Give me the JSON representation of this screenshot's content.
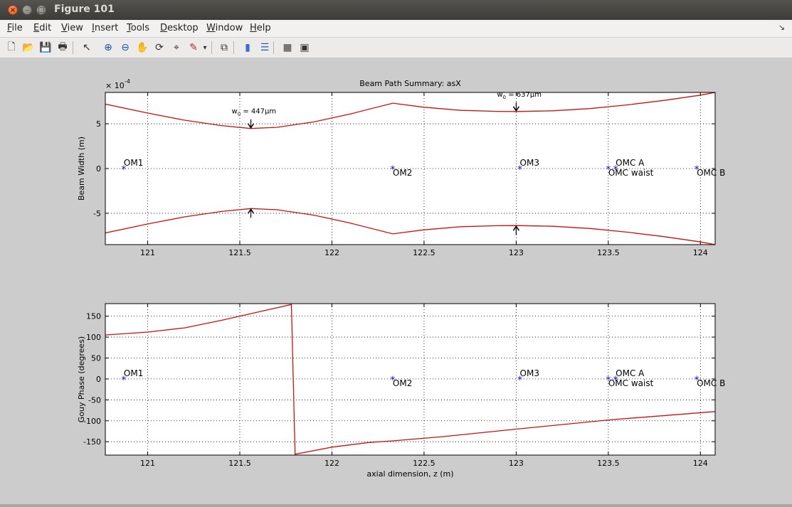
{
  "window": {
    "title": "Figure 101"
  },
  "menu": [
    {
      "label": "File",
      "mn": "F",
      "rest": "ile"
    },
    {
      "label": "Edit",
      "mn": "E",
      "rest": "dit"
    },
    {
      "label": "View",
      "mn": "V",
      "rest": "iew"
    },
    {
      "label": "Insert",
      "mn": "I",
      "rest": "nsert"
    },
    {
      "label": "Tools",
      "mn": "T",
      "rest": "ools"
    },
    {
      "label": "Desktop",
      "mn": "D",
      "rest": "esktop"
    },
    {
      "label": "Window",
      "mn": "W",
      "rest": "indow"
    },
    {
      "label": "Help",
      "mn": "H",
      "rest": "elp"
    }
  ],
  "toolbar": [
    "new-file-icon",
    "open-folder-icon",
    "save-icon",
    "print-icon",
    "pointer-icon",
    "zoom-in-icon",
    "zoom-out-icon",
    "pan-hand-icon",
    "rotate-3d-icon",
    "data-cursor-icon",
    "brush-icon",
    "brush-dropdown-icon",
    "link-plot-icon",
    "colorbar-icon",
    "legend-icon",
    "hide-plot-tools-icon",
    "show-plot-tools-icon"
  ],
  "colors": {
    "curve": "#d01010",
    "marker": "#1010c8",
    "axes_bg": "#ffffff",
    "figure_bg": "#cccccc"
  },
  "chart_data": [
    {
      "type": "line",
      "title": "Beam Path Summary: asX",
      "xlabel": "",
      "ylabel": "Beam Width (m)",
      "y_exponent_label": "× 10",
      "y_exponent": "-4",
      "xlim": [
        120.77,
        124.08
      ],
      "ylim": [
        -8.5,
        8.5
      ],
      "xticks": [
        121,
        121.5,
        122,
        122.5,
        123,
        123.5,
        124
      ],
      "xtick_labels": [
        "121",
        "121.5",
        "122",
        "122.5",
        "123",
        "123.5",
        "124"
      ],
      "yticks": [
        -5,
        0,
        5
      ],
      "ytick_labels": [
        "-5",
        "0",
        "5"
      ],
      "grid": true,
      "series": [
        {
          "x": [
            120.77,
            121.0,
            121.2,
            121.4,
            121.56,
            121.7,
            121.9,
            122.1,
            122.33,
            122.5,
            122.7,
            122.9,
            123.0,
            123.2,
            123.4,
            123.6,
            123.8,
            124.0,
            124.08
          ],
          "y": [
            7.2,
            6.2,
            5.4,
            4.8,
            4.47,
            4.6,
            5.2,
            6.1,
            7.3,
            6.85,
            6.5,
            6.39,
            6.37,
            6.45,
            6.7,
            7.1,
            7.6,
            8.2,
            8.5
          ]
        },
        {
          "x": [
            120.77,
            121.0,
            121.2,
            121.4,
            121.56,
            121.7,
            121.9,
            122.1,
            122.33,
            122.5,
            122.7,
            122.9,
            123.0,
            123.2,
            123.4,
            123.6,
            123.8,
            124.0,
            124.08
          ],
          "y": [
            -7.2,
            -6.2,
            -5.4,
            -4.8,
            -4.47,
            -4.6,
            -5.2,
            -6.1,
            -7.3,
            -6.85,
            -6.5,
            -6.39,
            -6.37,
            -6.45,
            -6.7,
            -7.1,
            -7.6,
            -8.2,
            -8.5
          ]
        }
      ],
      "annotations": [
        {
          "x": 121.56,
          "y": 4.47,
          "text_main": "w",
          "text_sub": "0",
          "text_rest": " = 447μm"
        },
        {
          "x": 123.0,
          "y": 6.37,
          "text_main": "w",
          "text_sub": "0",
          "text_rest": " = 637μm"
        }
      ],
      "arrows_up": [
        {
          "x": 121.56,
          "y": -4.47
        },
        {
          "x": 123.0,
          "y": -6.37
        }
      ],
      "markers": [
        {
          "x": 120.87,
          "y": 0,
          "label": "OM1",
          "pos": "above"
        },
        {
          "x": 122.33,
          "y": 0,
          "label": "OM2",
          "pos": "below"
        },
        {
          "x": 123.02,
          "y": 0,
          "label": "OM3",
          "pos": "above"
        },
        {
          "x": 123.5,
          "y": 0,
          "label": "OMC waist",
          "pos": "below"
        },
        {
          "x": 123.54,
          "y": 0,
          "label": "OMC A",
          "pos": "above"
        },
        {
          "x": 123.98,
          "y": 0,
          "label": "OMC B",
          "pos": "below"
        }
      ]
    },
    {
      "type": "line",
      "title": "",
      "xlabel": "axial dimension, z (m)",
      "ylabel": "Gouy Phase (degrees)",
      "xlim": [
        120.77,
        124.08
      ],
      "ylim": [
        -182,
        180
      ],
      "xticks": [
        121,
        121.5,
        122,
        122.5,
        123,
        123.5,
        124
      ],
      "xtick_labels": [
        "121",
        "121.5",
        "122",
        "122.5",
        "123",
        "123.5",
        "124"
      ],
      "yticks": [
        -150,
        -100,
        -50,
        0,
        50,
        100,
        150
      ],
      "ytick_labels": [
        "-150",
        "-100",
        "-50",
        "0",
        "50",
        "100",
        "150"
      ],
      "grid": true,
      "series": [
        {
          "x": [
            120.77,
            121.0,
            121.2,
            121.4,
            121.6,
            121.78,
            121.8,
            122.0,
            122.2,
            122.33,
            122.6,
            123.0,
            123.5,
            124.08
          ],
          "y": [
            105,
            112,
            122,
            140,
            160,
            178,
            -180,
            -163,
            -152,
            -148,
            -138,
            -120,
            -98,
            -78
          ]
        }
      ],
      "markers": [
        {
          "x": 120.87,
          "y": 0,
          "label": "OM1",
          "pos": "above"
        },
        {
          "x": 122.33,
          "y": 0,
          "label": "OM2",
          "pos": "below"
        },
        {
          "x": 123.02,
          "y": 0,
          "label": "OM3",
          "pos": "above"
        },
        {
          "x": 123.5,
          "y": 0,
          "label": "OMC waist",
          "pos": "below"
        },
        {
          "x": 123.54,
          "y": 0,
          "label": "OMC A",
          "pos": "above"
        },
        {
          "x": 123.98,
          "y": 0,
          "label": "OMC B",
          "pos": "below"
        }
      ]
    }
  ]
}
